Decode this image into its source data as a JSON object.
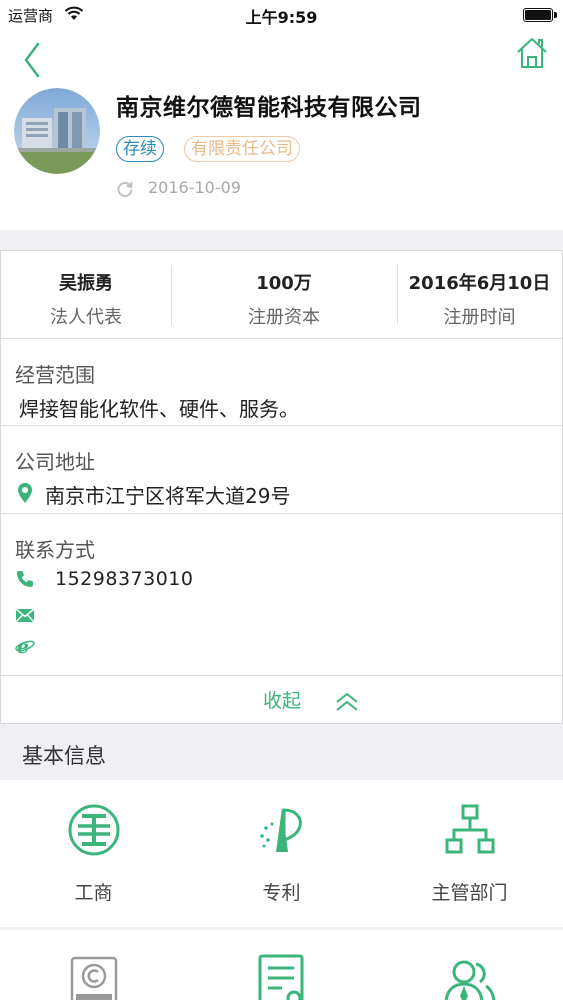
{
  "status_bar": {
    "carrier": "运营商",
    "time": "上午9:59"
  },
  "company": {
    "name": "南京维尔德智能科技有限公司",
    "status_tag": "存续",
    "type_tag": "有限责任公司",
    "date": "2016-10-09"
  },
  "stats": [
    {
      "value": "吴振勇",
      "label": "法人代表"
    },
    {
      "value": "100万",
      "label": "注册资本"
    },
    {
      "value": "2016年6月10日",
      "label": "注册时间"
    }
  ],
  "business_scope": {
    "title": "经营范围",
    "text": "焊接智能化软件、硬件、服务。"
  },
  "address": {
    "title": "公司地址",
    "text": "南京市江宁区将军大道29号"
  },
  "contact": {
    "title": "联系方式",
    "phone": "15298373010"
  },
  "collapse_label": "收起",
  "basic_info": {
    "title": "基本信息",
    "items": [
      {
        "label": "工商",
        "icon": "business-registration-icon"
      },
      {
        "label": "专利",
        "icon": "patent-icon"
      },
      {
        "label": "主管部门",
        "icon": "org-chart-icon"
      }
    ]
  },
  "colors": {
    "accent": "#3cb57a",
    "status_blue": "#2d8ab8",
    "tag_orange": "#e9b98a"
  }
}
